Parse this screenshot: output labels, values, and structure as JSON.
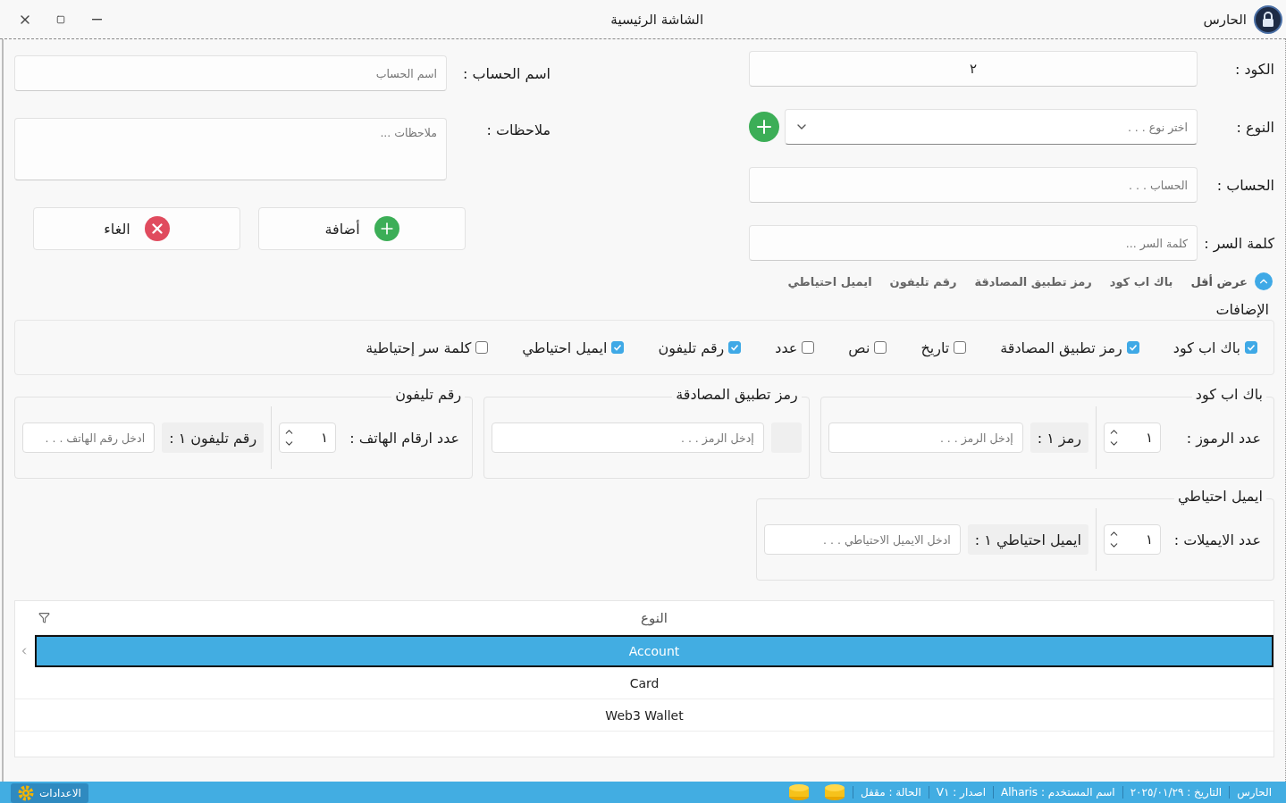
{
  "window": {
    "app_name": "الحارس",
    "title": "الشاشة الرئيسية"
  },
  "form": {
    "fields": [
      {
        "kind": "text",
        "label": "الكود :",
        "value": "٢"
      },
      {
        "kind": "combo",
        "label": "النوع :",
        "placeholder": "اختر نوع . . ."
      },
      {
        "kind": "text",
        "label": "الحساب :",
        "placeholder": "الحساب . . ."
      },
      {
        "kind": "text",
        "label": "كلمة السر :",
        "placeholder": "كلمة السر ..."
      }
    ],
    "toggle": {
      "label": "عرض أقل",
      "expanded": true
    },
    "chips": [
      "باك اب كود",
      "رمز تطبيق المصادقة",
      "رقم تليفون",
      "ايميل احتياطي"
    ],
    "side_fields": [
      {
        "kind": "text",
        "label": "اسم الحساب :",
        "placeholder": "اسم الحساب"
      },
      {
        "kind": "area",
        "label": "ملاحظات :",
        "placeholder": "ملاحظات ..."
      }
    ],
    "buttons": [
      {
        "kind": "add",
        "label": "أضافة"
      },
      {
        "kind": "cancel",
        "label": "الغاء"
      }
    ]
  },
  "extras": {
    "title": "الإضافات",
    "options": [
      {
        "label": "باك اب كود",
        "checked": true
      },
      {
        "label": "رمز تطبيق المصادقة",
        "checked": true
      },
      {
        "label": "تاريخ",
        "checked": false
      },
      {
        "label": "نص",
        "checked": false
      },
      {
        "label": "عدد",
        "checked": false
      },
      {
        "label": "رقم تليفون",
        "checked": true
      },
      {
        "label": "ايميل احتياطي",
        "checked": true
      },
      {
        "label": "كلمة سر إحتياطية",
        "checked": false
      }
    ]
  },
  "groups": [
    [
      {
        "kind": "counted",
        "title": "باك اب كود",
        "count_label": "عدد الرموز :",
        "count": "١",
        "item_label": "رمز ١ :",
        "placeholder": "إدخل الرمز . . ."
      },
      {
        "kind": "single",
        "title": "رمز تطبيق المصادقة",
        "placeholder": "إدخل الرمز . . ."
      },
      {
        "kind": "counted",
        "title": "رقم تليفون",
        "count_label": "عدد ارقام الهاتف :",
        "count": "١",
        "item_label": "رقم تليفون ١ :",
        "placeholder": "ادخل رقم الهاتف . . ."
      }
    ],
    [
      {
        "kind": "counted",
        "title": "ايميل احتياطي",
        "count_label": "عدد الايميلات :",
        "count": "١",
        "item_label": "ايميل احتياطي ١ :",
        "placeholder": "ادخل الايميل الاحتياطي . . ."
      }
    ]
  ],
  "table": {
    "columns": [
      "النوع"
    ],
    "rows": [
      {
        "cell": "Account",
        "selected": true
      },
      {
        "cell": "Card",
        "selected": false
      },
      {
        "cell": "Web3 Wallet",
        "selected": false
      }
    ]
  },
  "status_bar": {
    "items": [
      "الحارس",
      "التاريخ : ٢٠٢٥/٠١/٢٩",
      "اسم المستخدم : Alharis",
      "اصدار : V١",
      "الحالة : مقفل"
    ],
    "settings": "الاعدادات"
  }
}
